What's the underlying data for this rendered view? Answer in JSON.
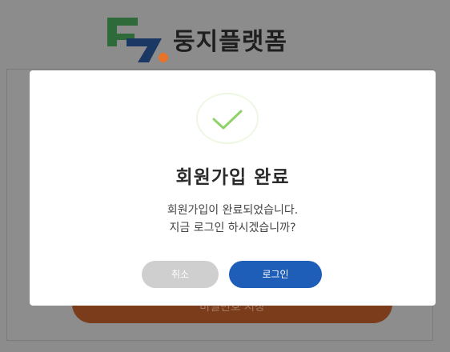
{
  "brand": {
    "logo_text": "둥지플랫폼",
    "logo_colors": {
      "green": "#2f6b3a",
      "navy": "#1b3764",
      "orange": "#e8732b"
    }
  },
  "background": {
    "save_button_label": "비밀번호 저장"
  },
  "modal": {
    "title": "회원가입 완료",
    "message_line1": "회원가입이 완료되었습니다.",
    "message_line2": "지금 로그인 하시겠습니까?",
    "cancel_label": "취소",
    "login_label": "로그인",
    "check_color": "#8fd16a",
    "login_color": "#1f5eb8"
  }
}
